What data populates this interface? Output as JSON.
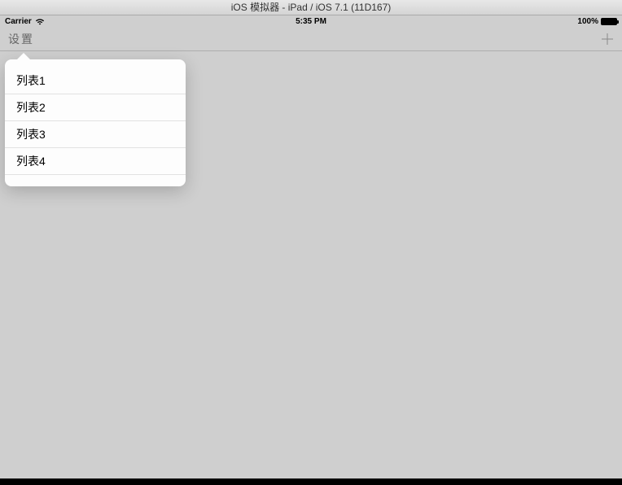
{
  "window": {
    "title": "iOS 模拟器 - iPad / iOS 7.1 (11D167)"
  },
  "status_bar": {
    "carrier": "Carrier",
    "time": "5:35 PM",
    "battery_pct": "100%"
  },
  "nav": {
    "left_label": "设置",
    "right_icon": "plus"
  },
  "popover": {
    "items": [
      {
        "label": "列表1"
      },
      {
        "label": "列表2"
      },
      {
        "label": "列表3"
      },
      {
        "label": "列表4"
      }
    ]
  }
}
